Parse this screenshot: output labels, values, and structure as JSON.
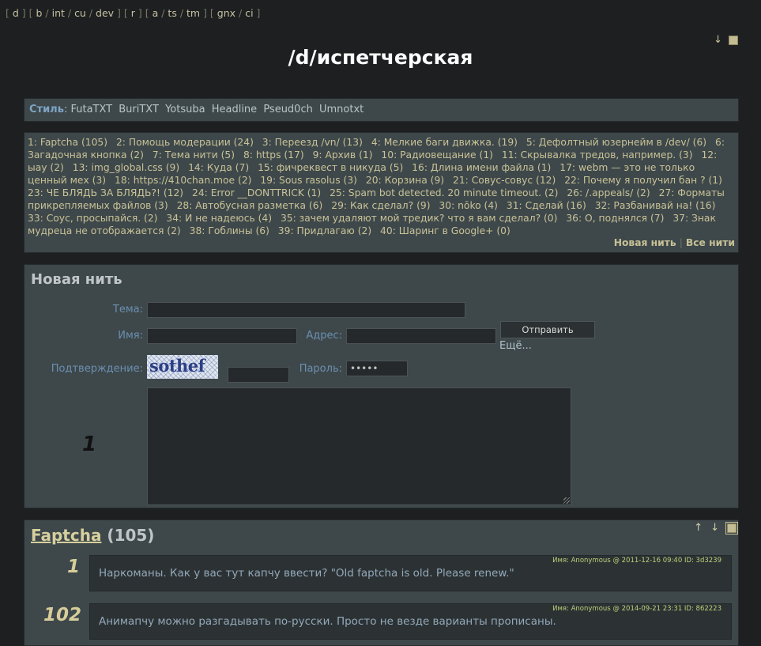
{
  "topnav": [
    {
      "group": [
        "d"
      ]
    },
    {
      "group": [
        "b",
        "int",
        "cu",
        "dev"
      ]
    },
    {
      "group": [
        "r"
      ]
    },
    {
      "group": [
        "a",
        "ts",
        "tm"
      ]
    },
    {
      "group": [
        "gnx",
        "ci"
      ]
    }
  ],
  "corner": {
    "down_arrow": "↓"
  },
  "page_title": "/d/испетчерская",
  "style_bar": {
    "label": "Стиль",
    "colon": ":",
    "styles": [
      "FutaTXT",
      "BuriTXT",
      "Yotsuba",
      "Headline",
      "Pseud0ch",
      "Umnotxt"
    ]
  },
  "thread_list": {
    "items": [
      "1: Faptcha (105)",
      "2: Помощь модерации (24)",
      "3: Переезд /vn/ (13)",
      "4: Мелкие баги движка. (19)",
      "5: Дефолтный юзернейм в /dev/ (6)",
      "6: Загадочная кнопка (2)",
      "7: Тема нити (5)",
      "8: https (17)",
      "9: Архив (1)",
      "10: Радиовещание (1)",
      "11: Скрывалка тредов, например. (3)",
      "12: ыау (2)",
      "13: img_global.css (9)",
      "14: Куда (7)",
      "15: фичреквест в никуда (5)",
      "16: Длина имени файла (1)",
      "17: webm — это не только ценный мех (3)",
      "18: https://410chan.moe (2)",
      "19: Sous rasolus (3)",
      "20: Корзина (9)",
      "21: Совус-совус (12)",
      "22: Почему я получил бан ? (1)",
      "23: ЧЕ БЛЯДЬ ЗА БЛЯДЬ?! (12)",
      "24: Error __DONTTRICK (1)",
      "25: Spam bot detected. 20 minute timeout. (2)",
      "26: /.appeals/ (2)",
      "27: Форматы прикрепляемых файлов (3)",
      "28: Автобусная разметка (6)",
      "29: Как сделал? (9)",
      "30: nōko (4)",
      "31: Сделай (16)",
      "32: Разбанивай на! (16)",
      "33: Соус, просыпайся. (2)",
      "34: И не надеюсь (4)",
      "35: зачем удаляют мой тредик? что я вам сделал? (0)",
      "36: О, поднялся (7)",
      "37: Знак мудреца не отображается (2)",
      "38: Гоблины (6)",
      "39: Придлагаю (2)",
      "40: Шаринг в Google+ (0)"
    ],
    "new_thread": "Новая нить",
    "separator": "|",
    "all_threads": "Все нити"
  },
  "form": {
    "heading": "Новая нить",
    "subject_label": "Тема:",
    "subject_value": "",
    "name_label": "Имя:",
    "name_value": "",
    "email_label": "Адрес:",
    "email_value": "",
    "submit_label": "Отправить",
    "more_link": "Ещё...",
    "captcha_label": "Подтверждение:",
    "captcha_text": "sothef",
    "captcha_value": "",
    "password_label": "Пароль:",
    "password_value": "•••••",
    "message_value": "",
    "side_number": "1"
  },
  "thread": {
    "title_link": "Faptcha",
    "reply_count": "(105)",
    "up_arrow": "↑",
    "down_arrow": "↓",
    "posts": [
      {
        "number": "1",
        "meta": "Имя: Anonymous @ 2011-12-16 09:40 ID: 3d3239",
        "text": "Наркоманы. Как у вас тут капчу ввести? \"Old faptcha is old. Please renew.\""
      },
      {
        "number": "102",
        "meta": "Имя: Anonymous @ 2014-09-21 23:31 ID: 862223",
        "text": "Анимапчу можно разгадывать по-русски. Просто не везде варианты прописаны."
      }
    ]
  },
  "colors": {
    "background": "#1d1f21",
    "panel": "#3e484b",
    "accent_gold": "#d6cd9a",
    "label_blue": "#6b8fb0",
    "meta_green": "#bcd07a"
  }
}
